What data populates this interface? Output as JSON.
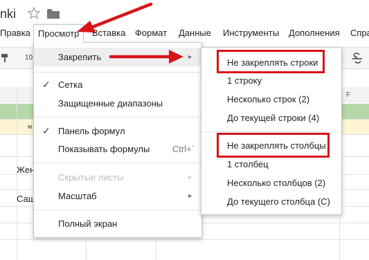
{
  "title": "nki",
  "menubar": {
    "items": [
      "Правка",
      "Просмотр",
      "Вставка",
      "Формат",
      "Данные",
      "Инструменты",
      "Дополнения",
      "Спра"
    ],
    "active": "Просмотр"
  },
  "toolbar": {
    "font_size": "10"
  },
  "grid": {
    "column_f": "F",
    "cells": {
      "yellow_m": "м",
      "zhen": "Жен",
      "sash": "Саш"
    }
  },
  "view_menu": {
    "items": [
      {
        "label": "Закрепить",
        "submenu": true,
        "highlighted": true
      },
      {
        "label": "Сетка",
        "checked": true
      },
      {
        "label": "Защищенные диапазоны"
      },
      {
        "label": "Панель формул",
        "checked": true
      },
      {
        "label": "Показывать формулы",
        "shortcut": "Ctrl+`"
      },
      {
        "label": "Скрытые листы",
        "submenu": true,
        "disabled": true
      },
      {
        "label": "Масштаб",
        "submenu": true
      },
      {
        "label": "Полный экран"
      }
    ]
  },
  "freeze_submenu": {
    "rows": [
      "Не закреплять строки",
      "1 строку",
      "Несколько строк (2)",
      "До текущей строки (4)"
    ],
    "cols": [
      "Не закреплять столбцы",
      "1 столбец",
      "Несколько столбцов (2)",
      "До текущего столбца (C)"
    ]
  },
  "colors": {
    "highlight_red": "#d7141a",
    "green_row": "#b7d7a8",
    "yellow_row": "#fdf4d4"
  }
}
